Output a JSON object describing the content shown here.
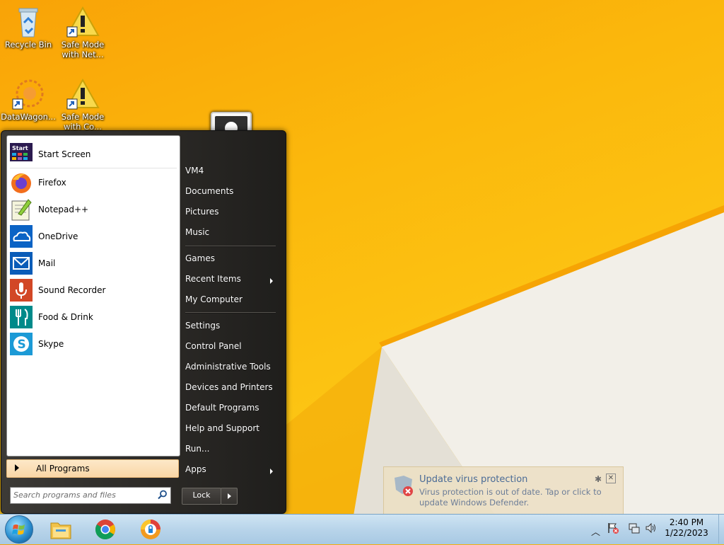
{
  "desktop": {
    "icons": [
      {
        "label": "Recycle Bin"
      },
      {
        "label": "Safe Mode with Net..."
      },
      {
        "label": "DataWagon..."
      },
      {
        "label": "Safe Mode with Co..."
      }
    ]
  },
  "start_menu": {
    "programs": [
      {
        "label": "Start Screen",
        "icon": "start-screen-icon"
      },
      {
        "label": "Firefox",
        "icon": "firefox-icon"
      },
      {
        "label": "Notepad++",
        "icon": "notepadpp-icon"
      },
      {
        "label": "OneDrive",
        "icon": "onedrive-icon"
      },
      {
        "label": "Mail",
        "icon": "mail-icon"
      },
      {
        "label": "Sound Recorder",
        "icon": "microphone-icon"
      },
      {
        "label": "Food & Drink",
        "icon": "food-drink-icon"
      },
      {
        "label": "Skype",
        "icon": "skype-icon"
      }
    ],
    "start_icon_text": "Start",
    "all_programs": "All Programs",
    "search_placeholder": "Search programs and files",
    "right_items": [
      {
        "label": "VM4"
      },
      {
        "label": "Documents"
      },
      {
        "label": "Pictures"
      },
      {
        "label": "Music"
      },
      {
        "label": "Games"
      },
      {
        "label": "Recent Items"
      },
      {
        "label": "My Computer"
      },
      {
        "label": "Settings"
      },
      {
        "label": "Control Panel"
      },
      {
        "label": "Administrative Tools"
      },
      {
        "label": "Devices and Printers"
      },
      {
        "label": "Default Programs"
      },
      {
        "label": "Help and Support"
      },
      {
        "label": "Run..."
      },
      {
        "label": "Apps"
      }
    ],
    "lock_label": "Lock"
  },
  "notification": {
    "title": "Update virus protection",
    "message": "Virus protection is out of date. Tap or click to update Windows Defender."
  },
  "taskbar": {
    "time": "2:40 PM",
    "date": "1/22/2023",
    "pinned": [
      "file-explorer-icon",
      "chrome-icon",
      "lock-app-icon"
    ]
  },
  "colors": {
    "wallpaper": "#fbb80c",
    "menu_dark": "#2a2825",
    "all_programs_highlight": "#f9d6a6",
    "taskbar": "#b8d4ea"
  }
}
